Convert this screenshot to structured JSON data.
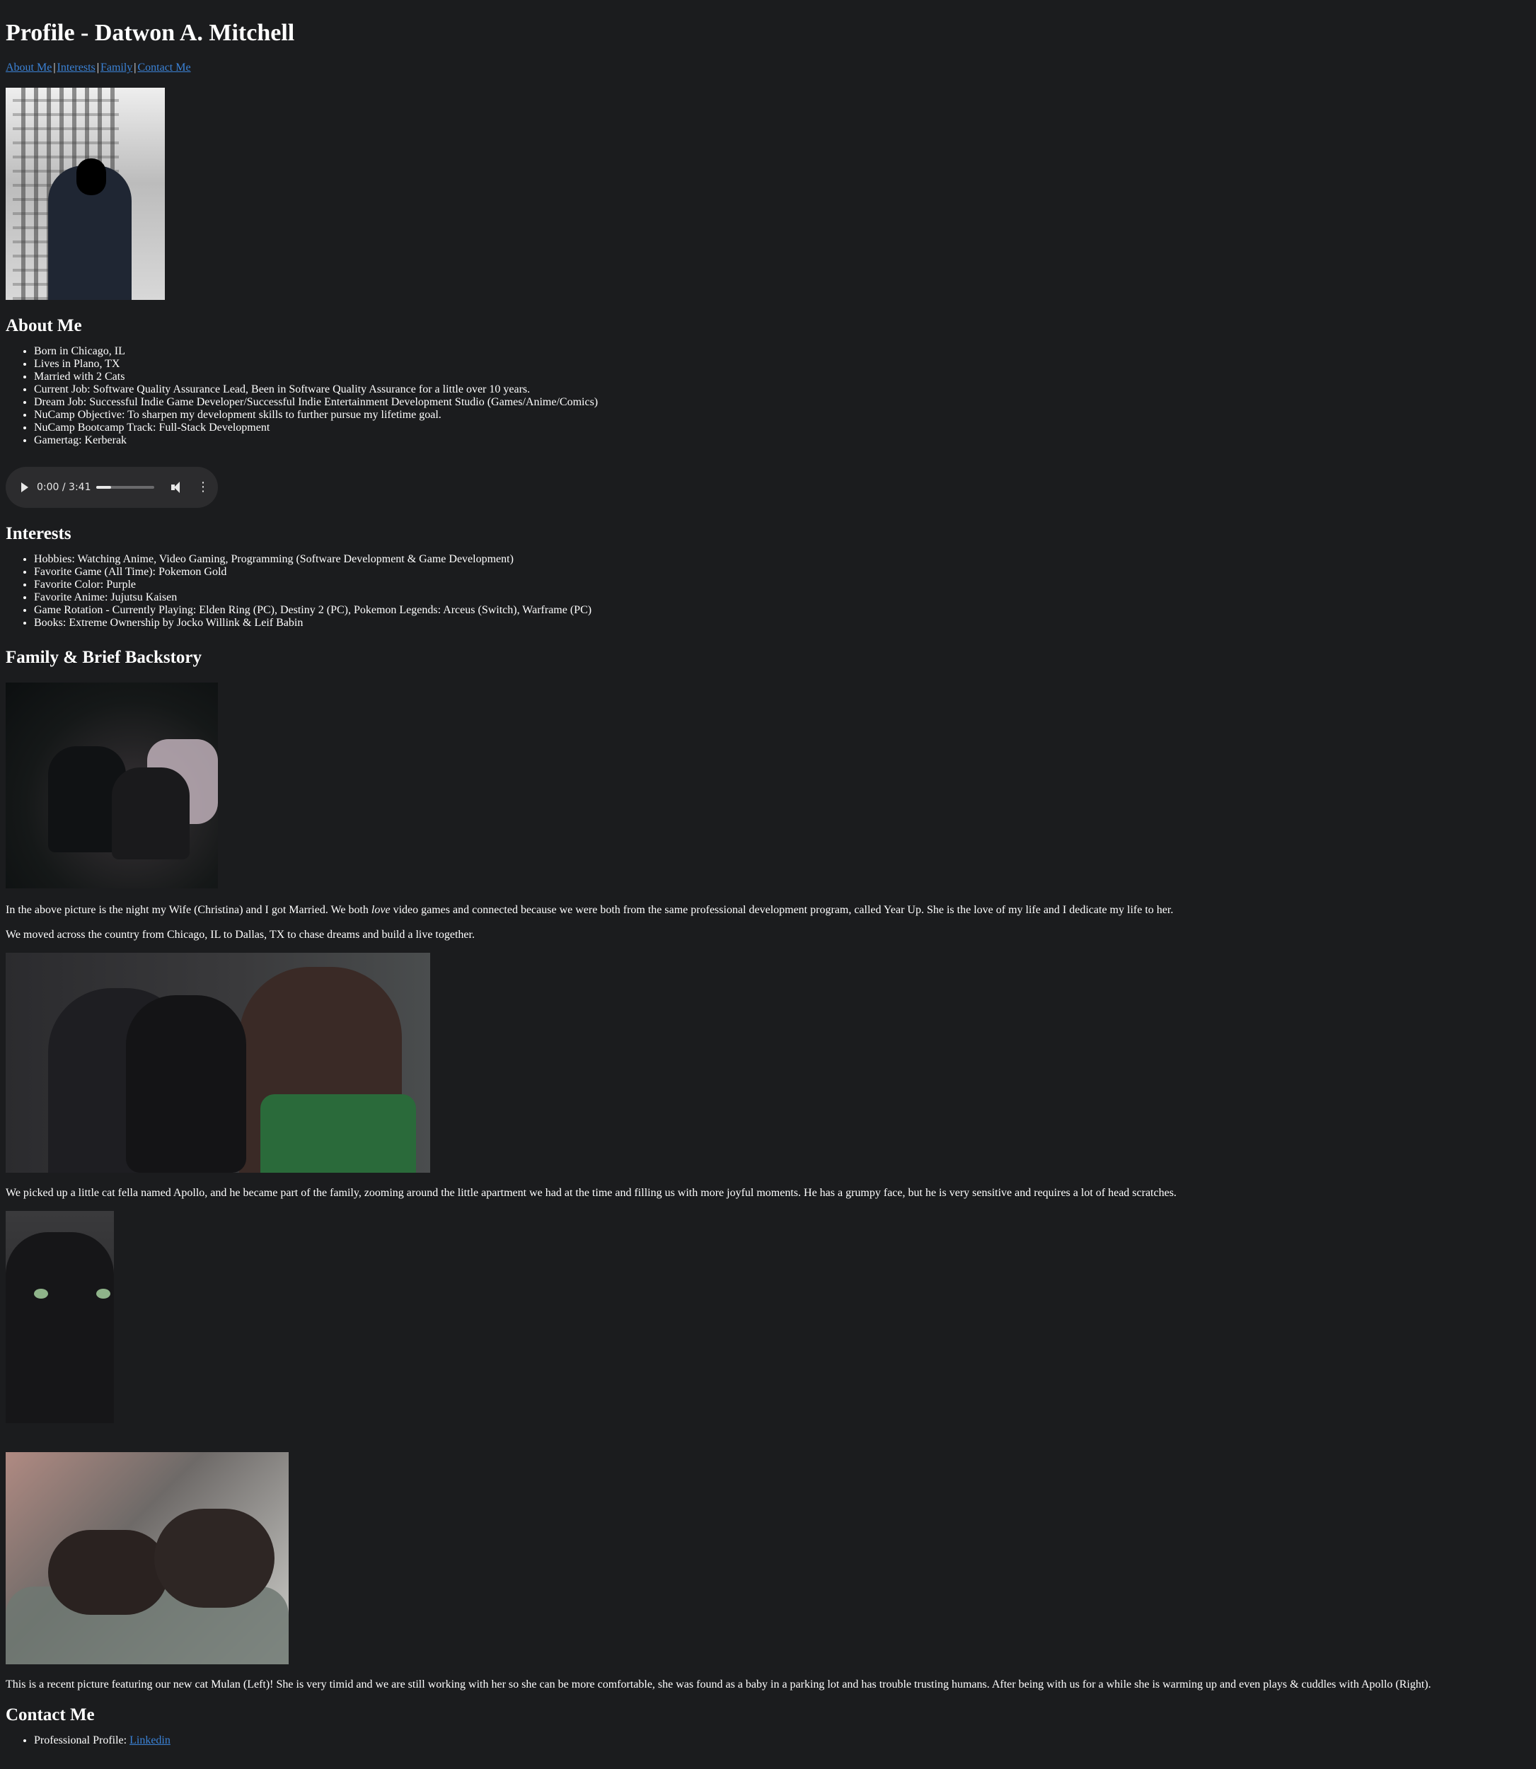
{
  "page": {
    "title": "Profile - Datwon A. Mitchell"
  },
  "nav": {
    "links": [
      "About Me",
      "Interests",
      "Family",
      "Contact Me"
    ],
    "separator": "|"
  },
  "about": {
    "heading": "About Me",
    "items": [
      "Born in Chicago, IL",
      "Lives in Plano, TX",
      "Married with 2 Cats",
      "Current Job: Software Quality Assurance Lead, Been in Software Quality Assurance for a little over 10 years.",
      "Dream Job: Successful Indie Game Developer/Successful Indie Entertainment Development Studio (Games/Anime/Comics)",
      "NuCamp Objective: To sharpen my development skills to further pursue my lifetime goal.",
      "NuCamp Bootcamp Track: Full-Stack Development",
      "Gamertag: Kerberak"
    ]
  },
  "audio": {
    "time": "0:00 / 3:41",
    "progress": 0.25
  },
  "interests": {
    "heading": "Interests",
    "items": [
      "Hobbies: Watching Anime, Video Gaming, Programming (Software Development & Game Development)",
      "Favorite Game (All Time): Pokemon Gold",
      "Favorite Color: Purple",
      "Favorite Anime: Jujutsu Kaisen",
      "Game Rotation - Currently Playing: Elden Ring (PC), Destiny 2 (PC), Pokemon Legends: Arceus (Switch), Warframe (PC)",
      "Books: Extreme Ownership by Jocko Willink & Leif Babin"
    ]
  },
  "family": {
    "heading": "Family & Brief Backstory",
    "para1_before": "In the above picture is the night my Wife (Christina) and I got Married. We both ",
    "para1_em": "love",
    "para1_after": " video games and connected because we were both from the same professional development program, called Year Up. She is the love of my life and I dedicate my life to her.",
    "para2": "We moved across the country from Chicago, IL to Dallas, TX to chase dreams and build a live together.",
    "para3": "We picked up a little cat fella named Apollo, and he became part of the family, zooming around the little apartment we had at the time and filling us with more joyful moments. He has a grumpy face, but he is very sensitive and requires a lot of head scratches.",
    "para4": "This is a recent picture featuring our new cat Mulan (Left)! She is very timid and we are still working with her so she can be more comfortable, she was found as a baby in a parking lot and has trouble trusting humans. After being with us for a while she is warming up and even plays & cuddles with Apollo (Right)."
  },
  "contact": {
    "heading": "Contact Me",
    "label": "Professional Profile: ",
    "link": "Linkedin"
  }
}
